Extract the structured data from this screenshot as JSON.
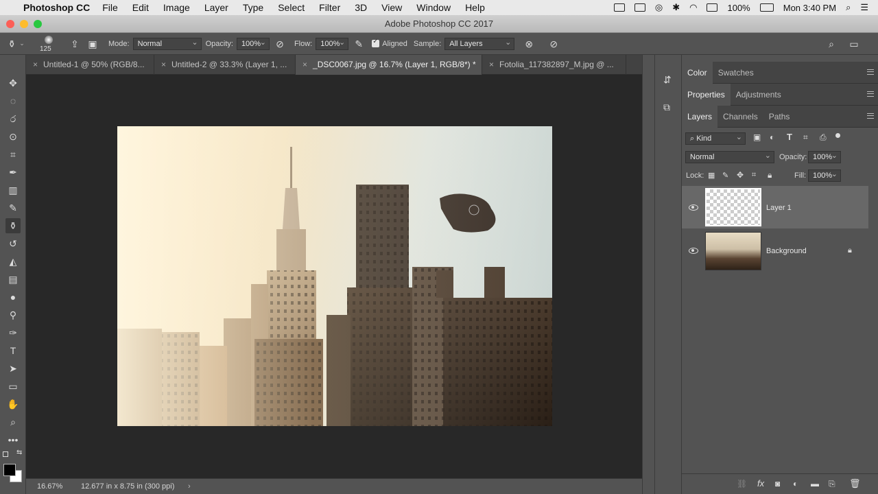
{
  "menubar": {
    "app": "Photoshop CC",
    "items": [
      "File",
      "Edit",
      "Image",
      "Layer",
      "Type",
      "Select",
      "Filter",
      "3D",
      "View",
      "Window",
      "Help"
    ],
    "battery": "100%",
    "clock": "Mon 3:40 PM"
  },
  "window": {
    "title": "Adobe Photoshop CC 2017"
  },
  "options": {
    "brush_size": "125",
    "mode_label": "Mode:",
    "mode_value": "Normal",
    "opacity_label": "Opacity:",
    "opacity_value": "100%",
    "flow_label": "Flow:",
    "flow_value": "100%",
    "aligned_label": "Aligned",
    "sample_label": "Sample:",
    "sample_value": "All Layers"
  },
  "tabs": [
    {
      "label": "Untitled-1 @ 50% (RGB/8..."
    },
    {
      "label": "Untitled-2 @ 33.3% (Layer 1, ..."
    },
    {
      "label": "_DSC0067.jpg @ 16.7% (Layer 1, RGB/8*) *"
    },
    {
      "label": "Fotolia_117382897_M.jpg @ ..."
    }
  ],
  "status": {
    "zoom": "16.67%",
    "doc_size": "12.677 in x 8.75 in (300 ppi)"
  },
  "panels": {
    "top_tabs": [
      "Color",
      "Swatches"
    ],
    "mid_tabs": [
      "Properties",
      "Adjustments"
    ],
    "layer_tabs": [
      "Layers",
      "Channels",
      "Paths"
    ],
    "filter_kind": "Kind",
    "blend_mode": "Normal",
    "opacity_label": "Opacity:",
    "opacity_value": "100%",
    "lock_label": "Lock:",
    "fill_label": "Fill:",
    "fill_value": "100%",
    "layers": [
      {
        "name": "Layer 1"
      },
      {
        "name": "Background"
      }
    ]
  },
  "colors": {
    "ui_dark": "#535353",
    "canvas_bg": "#282828",
    "selected_layer": "#686868"
  }
}
